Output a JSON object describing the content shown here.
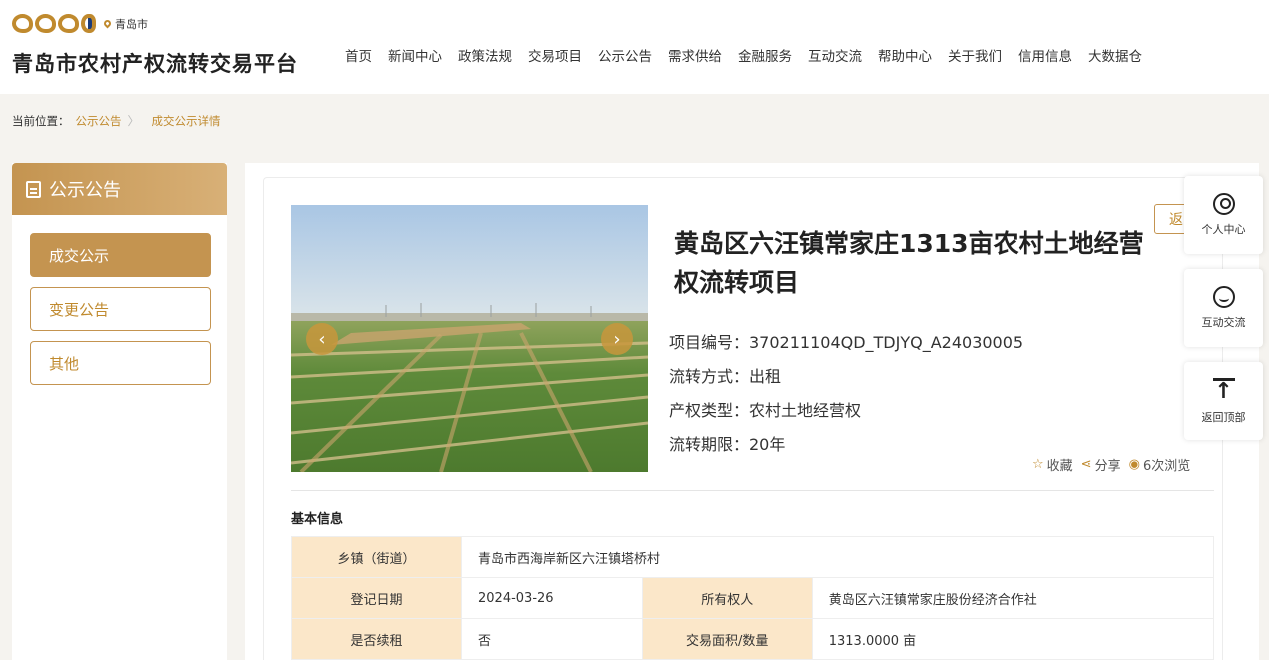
{
  "header": {
    "city": "青岛市",
    "site_title": "青岛市农村产权流转交易平台",
    "nav": [
      "首页",
      "新闻中心",
      "政策法规",
      "交易项目",
      "公示公告",
      "需求供给",
      "金融服务",
      "互动交流",
      "帮助中心",
      "关于我们",
      "信用信息",
      "大数据仓"
    ]
  },
  "breadcrumb": {
    "label": "当前位置：",
    "items": [
      "公示公告",
      "成交公示详情"
    ],
    "separator": "〉"
  },
  "sidebar": {
    "title": "公示公告",
    "items": [
      {
        "label": "成交公示",
        "active": true
      },
      {
        "label": "变更公告",
        "active": false
      },
      {
        "label": "其他",
        "active": false
      }
    ]
  },
  "project": {
    "title": "黄岛区六汪镇常家庄1313亩农村土地经营权流转项目",
    "back_label": "返",
    "fields": [
      "项目编号：370211104QD_TDJYQ_A24030005",
      "流转方式：出租",
      "产权类型：农村土地经营权",
      "流转期限：20年"
    ],
    "actions": {
      "favorite": "收藏",
      "share": "分享",
      "views": "6次浏览"
    }
  },
  "basic_info": {
    "title": "基本信息",
    "rows": [
      {
        "k1": "乡镇（街道）",
        "v1": "青岛市西海岸新区六汪镇塔桥村"
      },
      {
        "k1": "登记日期",
        "v1": "2024-03-26",
        "k2": "所有权人",
        "v2": "黄岛区六汪镇常家庄股份经济合作社"
      },
      {
        "k1": "是否续租",
        "v1": "否",
        "k2": "交易面积/数量",
        "v2": "1313.0000 亩"
      }
    ]
  },
  "floating": {
    "user_center": "个人中心",
    "interaction": "互动交流",
    "back_top": "返回顶部"
  },
  "colors": {
    "accent": "#c08a2e",
    "sidebar_head": "#c49450",
    "table_key_bg": "#fbe7c9"
  }
}
